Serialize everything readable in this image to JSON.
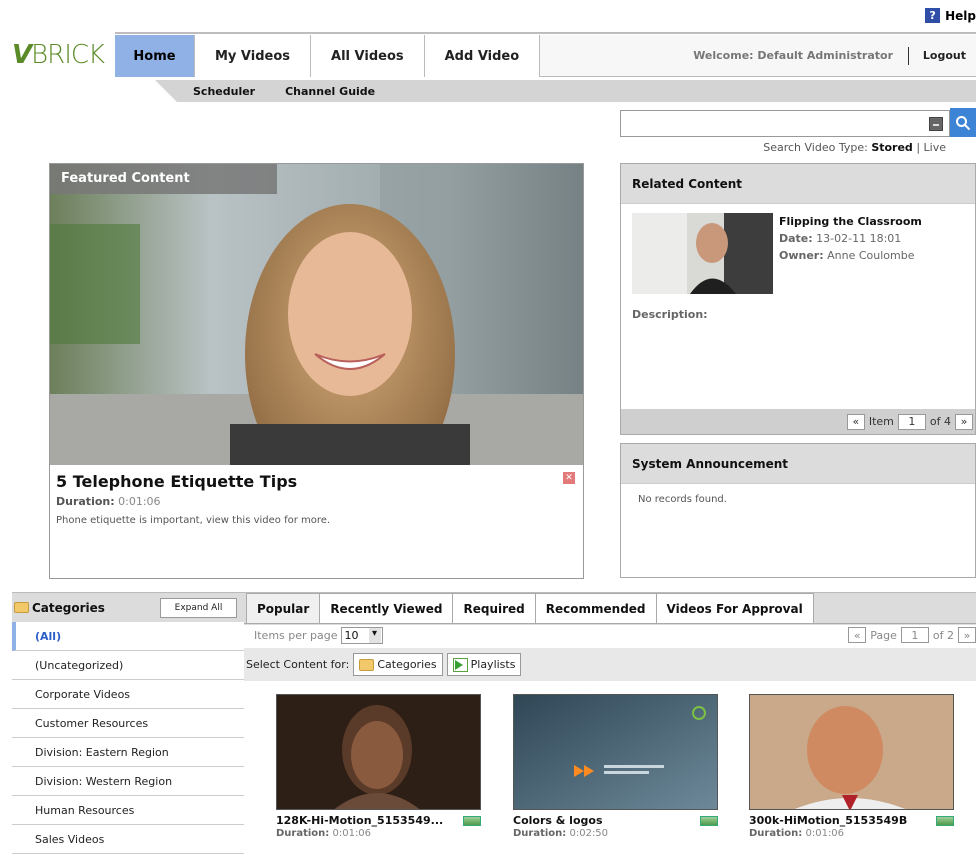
{
  "header": {
    "help_label": "Help",
    "logo_text": "BRICK",
    "nav": [
      "Home",
      "My Videos",
      "All Videos",
      "Add Video"
    ],
    "welcome": "Welcome: Default Administrator",
    "logout": "Logout",
    "subnav": [
      "Scheduler",
      "Channel Guide"
    ]
  },
  "search": {
    "type_label": "Search Video Type:",
    "type_stored": "Stored",
    "type_sep": "|",
    "type_live": "Live"
  },
  "featured": {
    "header": "Featured Content",
    "title": "5 Telephone Etiquette Tips",
    "duration_label": "Duration:",
    "duration": "0:01:06",
    "description": "Phone etiquette is important, view this video for more."
  },
  "related": {
    "header": "Related Content",
    "title": "Flipping the Classroom",
    "date_label": "Date:",
    "date": "13-02-11 18:01",
    "owner_label": "Owner:",
    "owner": "Anne Coulombe",
    "description_label": "Description:",
    "pager": {
      "prev": "«",
      "item_label": "Item",
      "current": "1",
      "of_label": "of 4",
      "next": "»"
    }
  },
  "announcement": {
    "header": "System Announcement",
    "text": "No records found."
  },
  "categories": {
    "header": "Categories",
    "expand_all": "Expand All",
    "items": [
      "(All)",
      "(Uncategorized)",
      "Corporate Videos",
      "Customer Resources",
      "Division: Eastern Region",
      "Division: Western Region",
      "Human Resources",
      "Sales Videos"
    ]
  },
  "content": {
    "tabs": [
      "Popular",
      "Recently Viewed",
      "Required",
      "Recommended",
      "Videos For Approval"
    ],
    "items_per_page_label": "Items per page",
    "items_per_page": "10",
    "pager": {
      "prev": "«",
      "page_label": "Page",
      "current": "1",
      "of_label": "of 2",
      "next": "»"
    },
    "select_label": "Select Content for:",
    "categories_btn": "Categories",
    "playlists_btn": "Playlists",
    "videos": [
      {
        "title": "128K-Hi-Motion_5153549...",
        "duration_label": "Duration:",
        "duration": "0:01:06"
      },
      {
        "title": "Colors & logos",
        "duration_label": "Duration:",
        "duration": "0:02:50"
      },
      {
        "title": "300k-HiMotion_5153549B",
        "duration_label": "Duration:",
        "duration": "0:01:06"
      }
    ]
  }
}
